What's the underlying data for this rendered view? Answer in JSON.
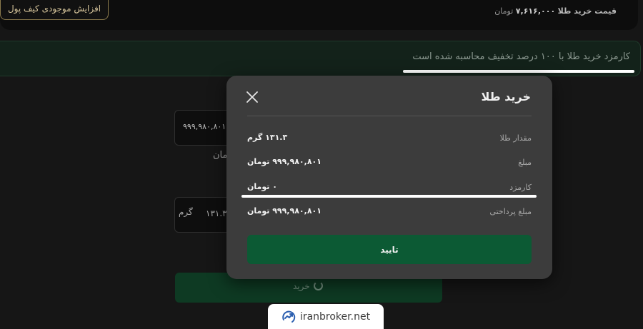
{
  "header": {
    "wallet_button": "افزایش موجودی کیف پول",
    "price_label": "قیمت خرید طلا",
    "price_value": "۷,۶۱۶,۰۰۰",
    "price_unit": "تومان"
  },
  "notice": {
    "text": "کارمزد خرید طلا با ۱۰۰ درصد تخفیف محاسبه شده است"
  },
  "background_form": {
    "amount_value": "۹۹۹,۹۸۰,۸۰۱",
    "amount_unit": "تومان",
    "gram_value": "۱۳۱.۳",
    "gram_unit": "گرم",
    "buy_button": "خرید"
  },
  "modal": {
    "title": "خرید طلا",
    "rows": [
      {
        "label": "مقدار طلا",
        "value": "۱۳۱.۳ گرم"
      },
      {
        "label": "مبلغ",
        "value": "۹۹۹,۹۸۰,۸۰۱ تومان"
      },
      {
        "label": "کارمزد",
        "value": "۰ تومان"
      },
      {
        "label": "مبلغ پرداختی",
        "value": "۹۹۹,۹۸۰,۸۰۱ تومان"
      }
    ],
    "confirm_button": "تایید"
  },
  "watermark": {
    "text": "iranbroker.net"
  },
  "colors": {
    "background": "#161616",
    "modal_bg": "#3c3c3c",
    "accent_green": "#0c5a34",
    "gold_border": "#8a7a4c"
  }
}
